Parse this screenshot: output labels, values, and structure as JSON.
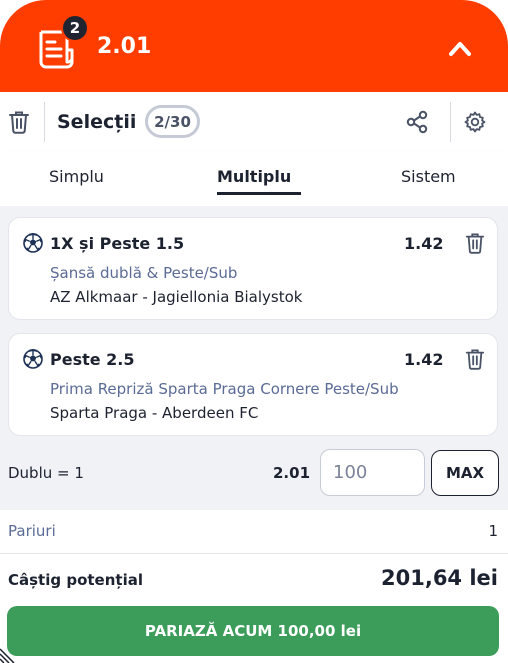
{
  "header": {
    "badge_count": "2",
    "total_odds": "2.01",
    "icons": {
      "ticket": "ticket-icon",
      "collapse": "chevron-up-icon"
    },
    "background_color": "#ff3d00"
  },
  "toolbar": {
    "title": "Selecții",
    "selection_count": "2/30",
    "icons": {
      "delete": "trash-icon",
      "share": "share-icon",
      "settings": "gear-icon"
    }
  },
  "tabs": [
    {
      "label": "Simplu",
      "active": false
    },
    {
      "label": "Multiplu",
      "active": true
    },
    {
      "label": "Sistem",
      "active": false
    }
  ],
  "selections": [
    {
      "title": "1X și Peste 1.5",
      "odds": "1.42",
      "market": "Șansă dublă & Peste/Sub",
      "event": "AZ Alkmaar - Jagiellonia Bialystok",
      "icon": "soccer-ball-icon"
    },
    {
      "title": "Peste 2.5",
      "odds": "1.42",
      "market": "Prima Repriză Sparta Praga Cornere Peste/Sub",
      "event": "Sparta Praga - Aberdeen FC",
      "icon": "soccer-ball-icon"
    }
  ],
  "stake": {
    "combo_label": "Dublu = 1",
    "combo_odds": "2.01",
    "placeholder": "100",
    "max_label": "MAX"
  },
  "summary": {
    "bets_label": "Pariuri",
    "bets_value": "1",
    "potential_label": "Câștig potențial",
    "potential_value": "201,64 lei",
    "bet_button_label": "PARIAZĂ ACUM 100,00 lei",
    "bet_button_color": "#3c9d5a"
  }
}
